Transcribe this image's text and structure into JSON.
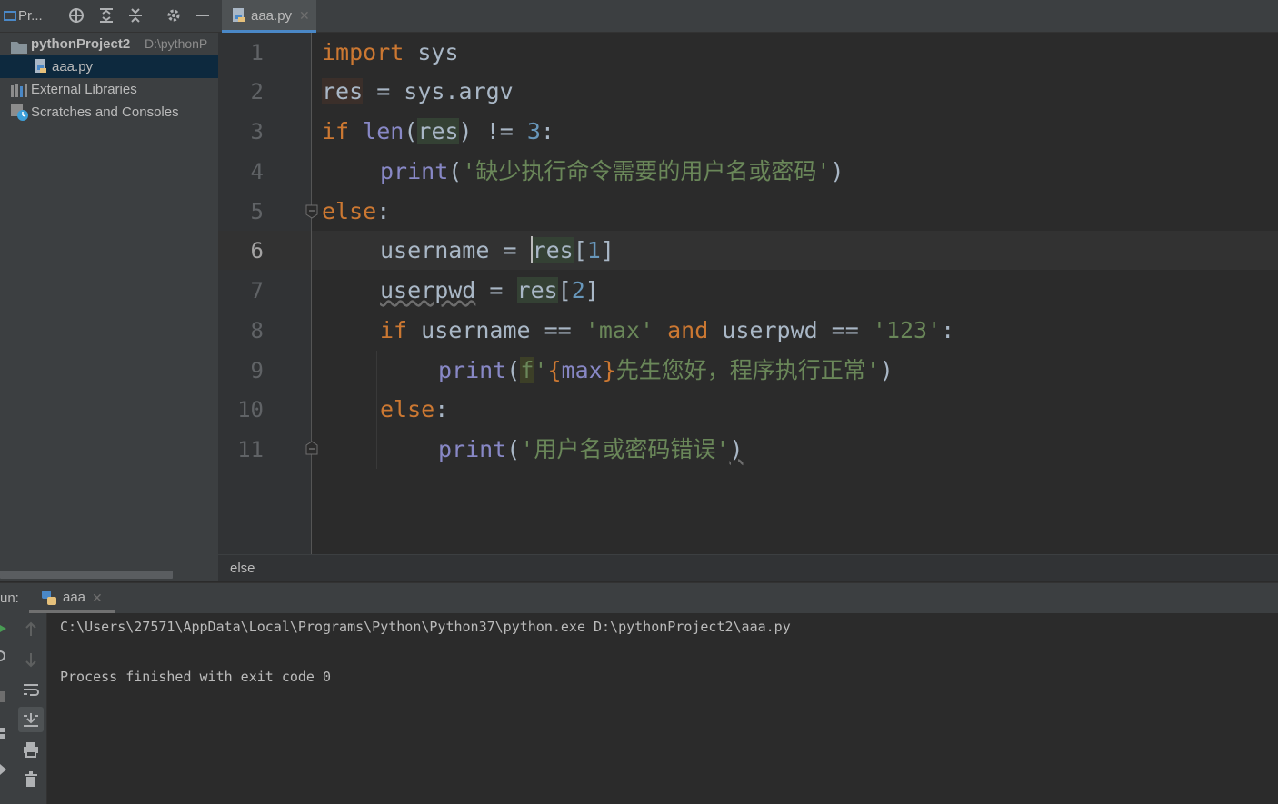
{
  "project_panel": {
    "title": "Pr...",
    "tree": [
      {
        "label": "pythonProject2",
        "path": "D:\\pythonP"
      },
      {
        "label": "aaa.py"
      },
      {
        "label": "External Libraries"
      },
      {
        "label": "Scratches and Consoles"
      }
    ]
  },
  "editor": {
    "tab_label": "aaa.py",
    "line_numbers": [
      "1",
      "2",
      "3",
      "4",
      "5",
      "6",
      "7",
      "8",
      "9",
      "10",
      "11"
    ],
    "current_line": "6",
    "tokens": {
      "l1_import": "import",
      "l1_rest": " sys",
      "l2_res": "res",
      "l2_rest": " = sys.argv",
      "l3_if": "if",
      "l3_len": " len",
      "l3_paren": "(",
      "l3_res": "res",
      "l3_op": ") != ",
      "l3_num": "3",
      "l3_colon": ":",
      "l4_print": "print",
      "l4_open": "(",
      "l4_str": "'缺少执行命令需要的用户名或密码'",
      "l4_close": ")",
      "l5_else": "else",
      "l5_colon": ":",
      "l6_var": "username = ",
      "l6_res": "res",
      "l6_open": "[",
      "l6_num": "1",
      "l6_close": "]",
      "l7_var": "userpwd",
      "l7_eq": " = ",
      "l7_res": "res",
      "l7_open": "[",
      "l7_num": "2",
      "l7_close": "]",
      "l8_if": "if",
      "l8_a": " username == ",
      "l8_max": "'max'",
      "l8_and": " and",
      "l8_b": " userpwd == ",
      "l8_123": "'123'",
      "l8_colon": ":",
      "l9_print": "print",
      "l9_open": "(",
      "l9_f": "f",
      "l9_q": "'",
      "l9_lb": "{",
      "l9_max": "max",
      "l9_rb": "}",
      "l9_str": "先生您好，程序执行正常'",
      "l9_close": ")",
      "l10_else": "else",
      "l10_colon": ":",
      "l11_print": "print",
      "l11_open": "(",
      "l11_str": "'用户名或密码错误'",
      "l11_close": ")"
    },
    "breadcrumb": "else"
  },
  "run_panel": {
    "label": "un:",
    "tab_label": "aaa",
    "console_lines": [
      "C:\\Users\\27571\\AppData\\Local\\Programs\\Python\\Python37\\python.exe D:\\pythonProject2\\aaa.py",
      "Process finished with exit code 0"
    ]
  },
  "colors": {
    "keyword": "#cc7832",
    "string": "#6a8759",
    "number": "#6897bb",
    "builtin": "#8888c6",
    "tab_accent": "#4a88c7"
  }
}
